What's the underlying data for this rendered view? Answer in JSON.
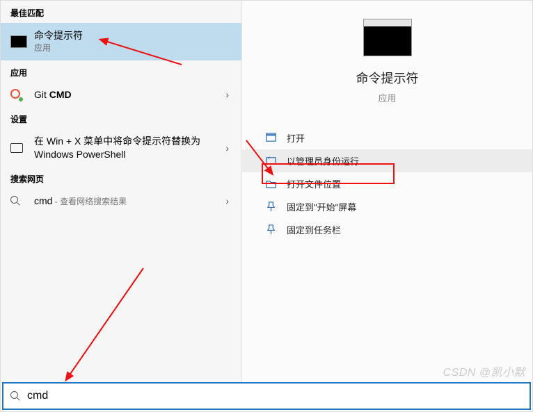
{
  "left": {
    "best_match_header": "最佳匹配",
    "best": {
      "title": "命令提示符",
      "sub": "应用"
    },
    "apps_header": "应用",
    "git": {
      "prefix": "Git ",
      "bold": "CMD"
    },
    "settings_header": "设置",
    "winx": "在 Win + X 菜单中将命令提示符替换为 Windows PowerShell",
    "web_header": "搜索网页",
    "web": {
      "prefix": "cmd",
      "suffix": " - 查看网络搜索结果"
    }
  },
  "right": {
    "title": "命令提示符",
    "sub": "应用",
    "actions": {
      "open": "打开",
      "admin": "以管理员身份运行",
      "location": "打开文件位置",
      "pin_start": "固定到\"开始\"屏幕",
      "pin_taskbar": "固定到任务栏"
    }
  },
  "search": {
    "value": "cmd"
  },
  "watermark": "CSDN @凯小默"
}
